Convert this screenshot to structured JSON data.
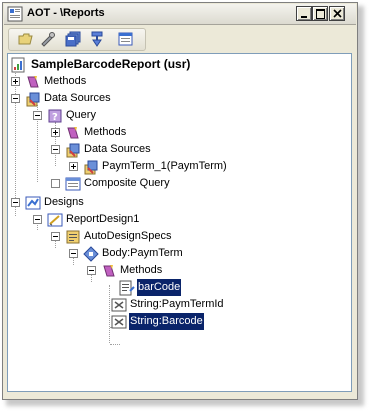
{
  "window": {
    "title": "AOT - \\Reports"
  },
  "toolbar": {
    "buttons": [
      "open-icon",
      "properties-icon",
      "save-all-icon",
      "compile-icon",
      "find-icon"
    ]
  },
  "tree": {
    "root": "SampleBarcodeReport (usr)",
    "methods": "Methods",
    "data_sources": "Data Sources",
    "query": "Query",
    "query_methods": "Methods",
    "query_data_sources": "Data Sources",
    "paym_term": "PaymTerm_1(PaymTerm)",
    "composite_query": "Composite Query",
    "designs": "Designs",
    "report_design": "ReportDesign1",
    "auto_design_specs": "AutoDesignSpecs",
    "body": "Body:PaymTerm",
    "body_methods": "Methods",
    "bar_code": "barCode",
    "string_paym_term_id": "String:PaymTermId",
    "string_barcode": "String:Barcode"
  },
  "colors": {
    "selection": "#0a246a"
  }
}
